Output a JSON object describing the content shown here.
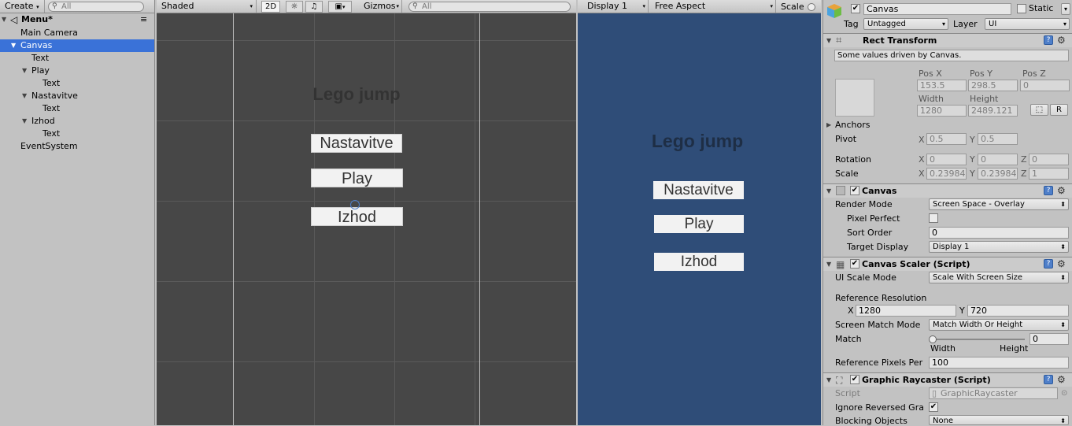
{
  "hierarchy": {
    "create_label": "Create",
    "search_placeholder": "All",
    "scene_name": "Menu*",
    "items": [
      {
        "label": "Main Camera"
      },
      {
        "label": "Canvas"
      },
      {
        "label": "Text"
      },
      {
        "label": "Play"
      },
      {
        "label": "Text"
      },
      {
        "label": "Nastavitve"
      },
      {
        "label": "Text"
      },
      {
        "label": "Izhod"
      },
      {
        "label": "Text"
      },
      {
        "label": "EventSystem"
      }
    ]
  },
  "scene_view": {
    "shading_mode": "Shaded",
    "mode_2d": "2D",
    "gizmos_label": "Gizmos",
    "search_placeholder": "All",
    "title_text": "Lego jump",
    "buttons": [
      "Nastavitve",
      "Play",
      "Izhod"
    ]
  },
  "game_view": {
    "display": "Display 1",
    "aspect": "Free Aspect",
    "scale_label": "Scale",
    "title_text": "Lego jump",
    "buttons": [
      "Nastavitve",
      "Play",
      "Izhod"
    ],
    "background_color": "#2f4d78"
  },
  "inspector": {
    "object_name": "Canvas",
    "static_label": "Static",
    "tag_label": "Tag",
    "tag_value": "Untagged",
    "layer_label": "Layer",
    "layer_value": "UI",
    "rect_transform": {
      "title": "Rect Transform",
      "info": "Some values driven by Canvas.",
      "pos_x_label": "Pos X",
      "pos_y_label": "Pos Y",
      "pos_z_label": "Pos Z",
      "pos_x": "153.5",
      "pos_y": "298.5",
      "pos_z": "0",
      "width_label": "Width",
      "height_label": "Height",
      "width": "1280",
      "height": "2489.121",
      "r_label": "R",
      "anchors_label": "Anchors",
      "pivot_label": "Pivot",
      "pivot_x": "0.5",
      "pivot_y": "0.5",
      "rotation_label": "Rotation",
      "rot_x": "0",
      "rot_y": "0",
      "rot_z": "0",
      "scale_label": "Scale",
      "scale_x": "0.23984",
      "scale_y": "0.23984",
      "scale_z": "1",
      "x_axis": "X",
      "y_axis": "Y",
      "z_axis": "Z"
    },
    "canvas": {
      "title": "Canvas",
      "render_mode_label": "Render Mode",
      "render_mode": "Screen Space - Overlay",
      "pixel_perfect_label": "Pixel Perfect",
      "sort_order_label": "Sort Order",
      "sort_order": "0",
      "target_display_label": "Target Display",
      "target_display": "Display 1"
    },
    "canvas_scaler": {
      "title": "Canvas Scaler (Script)",
      "ui_scale_mode_label": "UI Scale Mode",
      "ui_scale_mode": "Scale With Screen Size",
      "reference_resolution_label": "Reference Resolution",
      "ref_x": "1280",
      "ref_y": "720",
      "screen_match_mode_label": "Screen Match Mode",
      "screen_match_mode": "Match Width Or Height",
      "match_label": "Match",
      "match_value": "0",
      "width_label": "Width",
      "height_label": "Height",
      "ref_pixels_label": "Reference Pixels Per",
      "ref_pixels": "100"
    },
    "graphic_raycaster": {
      "title": "Graphic Raycaster (Script)",
      "script_label": "Script",
      "script_value": "GraphicRaycaster",
      "ignore_reversed_label": "Ignore Reversed Gra",
      "blocking_objects_label": "Blocking Objects",
      "blocking_objects": "None"
    }
  }
}
